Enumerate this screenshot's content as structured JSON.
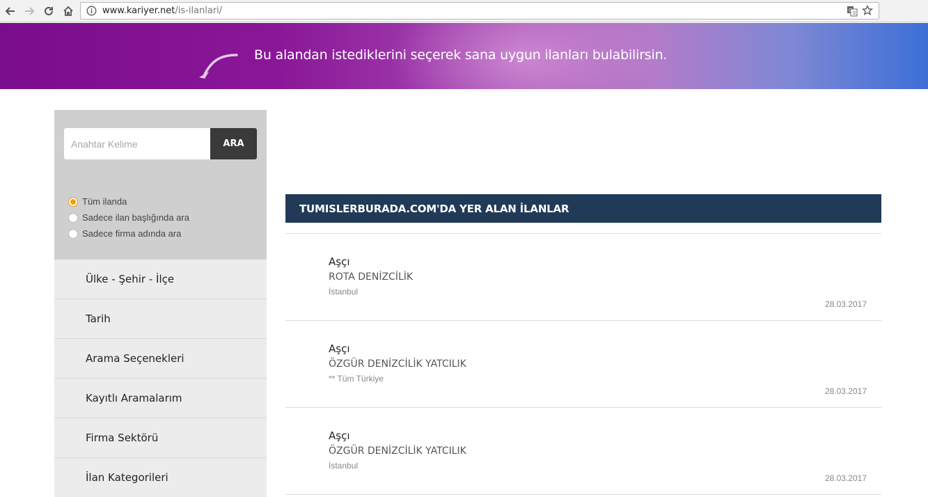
{
  "browser": {
    "url_domain": "www.kariyer.net",
    "url_path": "/is-ilanlari/",
    "icons": [
      "back-arrow-icon",
      "forward-arrow-icon",
      "reload-icon",
      "home-icon",
      "info-icon",
      "translate-icon",
      "star-icon"
    ]
  },
  "banner": {
    "text": "Bu alandan istediklerini seçerek sana uygun ilanları bulabilirsin."
  },
  "search": {
    "placeholder": "Anahtar Kelime",
    "button_label": "ARA",
    "options": [
      {
        "label": "Tüm ilanda",
        "checked": true
      },
      {
        "label": "Sadece ilan başlığında ara",
        "checked": false
      },
      {
        "label": "Sadece firma adında ara",
        "checked": false
      }
    ]
  },
  "filters": [
    "Ülke - Şehir - İlçe",
    "Tarih",
    "Arama Seçenekleri",
    "Kayıtlı Aramalarım",
    "Firma Sektörü",
    "İlan Kategorileri"
  ],
  "listing": {
    "header": "TUMISLERBURADA.COM'DA YER ALAN İLANLAR",
    "jobs": [
      {
        "title": "Aşçı",
        "company": "ROTA DENİZCİLİK",
        "location": "İstanbul",
        "date": "28.03.2017"
      },
      {
        "title": "Aşçı",
        "company": "ÖZGÜR DENİZCİLİK YATCILIK",
        "location": "** Tüm Türkiye",
        "date": "28.03.2017"
      },
      {
        "title": "Aşçı",
        "company": "ÖZGÜR DENİZCİLİK YATCILIK",
        "location": "İstanbul",
        "date": "28.03.2017"
      }
    ]
  },
  "colors": {
    "listing_header_bg": "#213a57",
    "radio_checked": "#f39c12",
    "search_button_bg": "#3a3a3a"
  }
}
